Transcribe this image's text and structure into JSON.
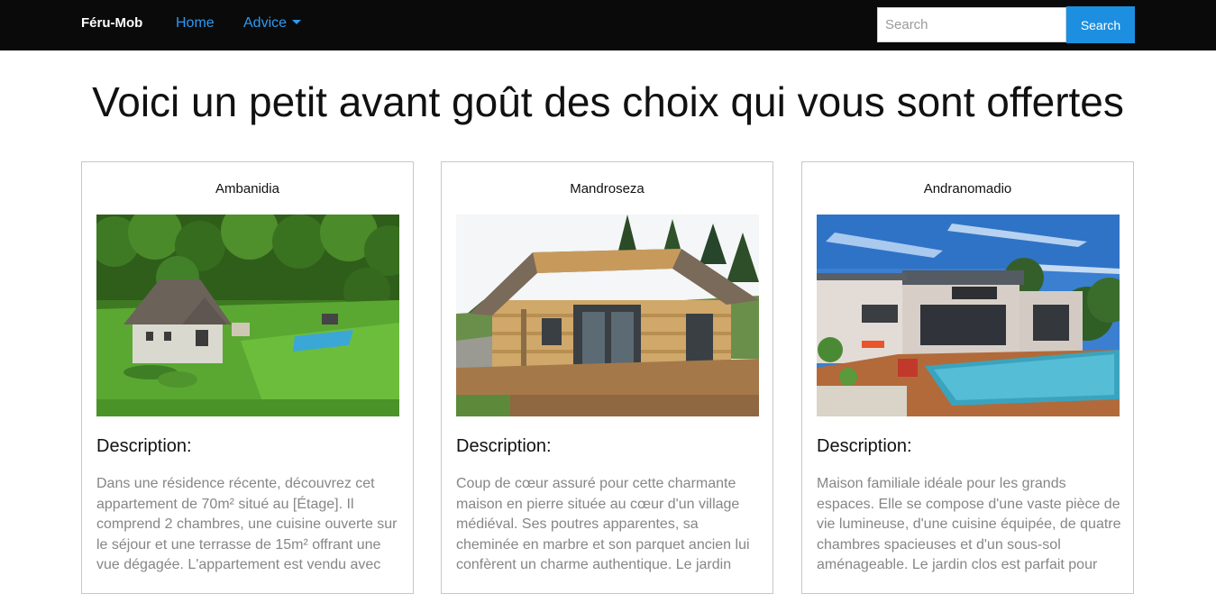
{
  "navbar": {
    "brand": "Féru-Mob",
    "home_label": "Home",
    "advice_label": "Advice",
    "search_placeholder": "Search",
    "search_button_label": "Search"
  },
  "main": {
    "heading": "Voici un petit avant goût des choix qui vous sont offertes",
    "cards": [
      {
        "title": "Ambanidia",
        "description_label": "Description:",
        "description": "Dans une résidence récente, découvrez cet appartement de 70m² situé au [Étage]. Il comprend 2 chambres, une cuisine ouverte sur le séjour et une terrasse de 15m² offrant une vue dégagée. L'appartement est vendu avec"
      },
      {
        "title": "Mandroseza",
        "description_label": "Description:",
        "description": "Coup de cœur assuré pour cette charmante maison en pierre située au cœur d'un village médiéval. Ses poutres apparentes, sa cheminée en marbre et son parquet ancien lui confèrent un charme authentique. Le jardin"
      },
      {
        "title": "Andranomadio",
        "description_label": "Description:",
        "description": "Maison familiale idéale pour les grands espaces. Elle se compose d'une vaste pièce de vie lumineuse, d'une cuisine équipée, de quatre chambres spacieuses et d'un sous-sol aménageable. Le jardin clos est parfait pour"
      }
    ]
  },
  "colors": {
    "navbar_bg": "#0a0a0a",
    "link": "#2b9af3",
    "search_button": "#1c8fe0",
    "description_text": "#868686"
  }
}
